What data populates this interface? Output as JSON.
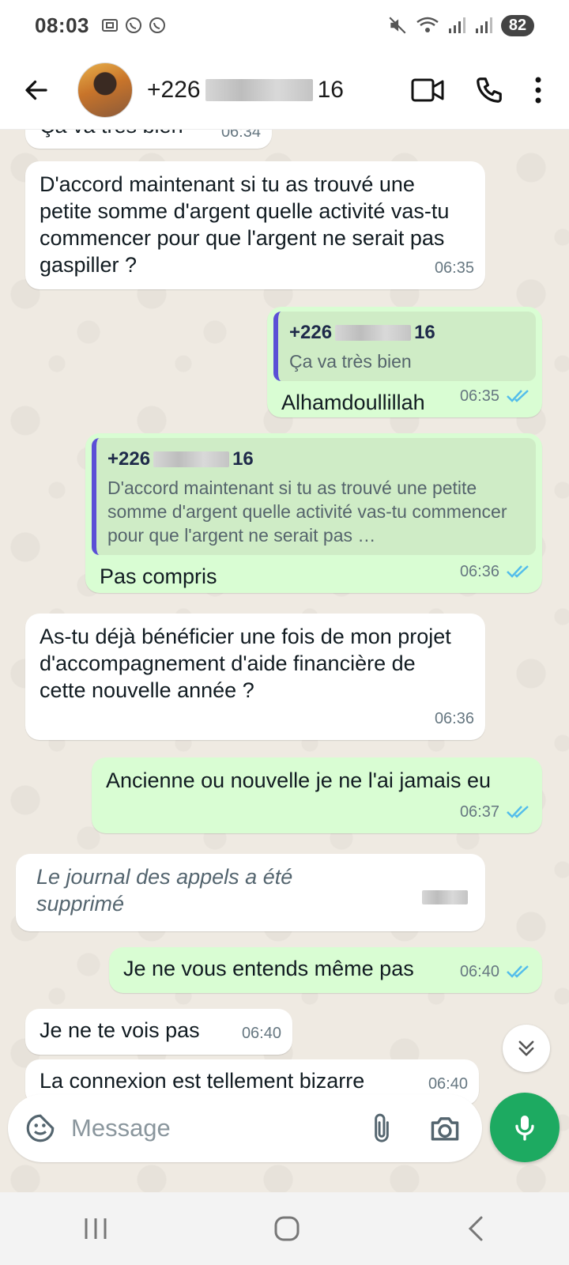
{
  "status_bar": {
    "time": "08:03",
    "battery": "82"
  },
  "header": {
    "contact_prefix": "+226",
    "contact_suffix": "16"
  },
  "messages": [
    {
      "id": "m0",
      "dir": "in",
      "text": "Ça va très bien",
      "time": "06:34"
    },
    {
      "id": "m1",
      "dir": "in",
      "text": "D'accord maintenant si tu as trouvé une petite somme d'argent quelle activité vas-tu commencer pour que l'argent ne serait pas gaspiller ?",
      "time": "06:35"
    },
    {
      "id": "m2",
      "dir": "out",
      "quote_name_prefix": "+226",
      "quote_name_suffix": "16",
      "quote_text": "Ça va très bien",
      "text": "Alhamdoullillah",
      "time": "06:35"
    },
    {
      "id": "m3",
      "dir": "out",
      "quote_name_prefix": "+226",
      "quote_name_suffix": "16",
      "quote_text": "D'accord maintenant si tu as trouvé une petite somme d'argent quelle activité vas-tu commencer pour que l'argent ne serait pas …",
      "text": "Pas compris",
      "time": "06:36"
    },
    {
      "id": "m4",
      "dir": "in",
      "text": "As-tu déjà bénéficier une fois de mon projet d'accompagnement d'aide financière de cette nouvelle année ?",
      "time": "06:36"
    },
    {
      "id": "m5",
      "dir": "out",
      "text": "Ancienne ou nouvelle je ne l'ai jamais eu",
      "time": "06:37"
    },
    {
      "id": "m6",
      "dir": "in",
      "text": "Le journal des appels a été supprimé",
      "time": ""
    },
    {
      "id": "m7",
      "dir": "out",
      "text": "Je ne vous entends même pas",
      "time": "06:40"
    },
    {
      "id": "m8",
      "dir": "in",
      "text": "Je ne te vois pas",
      "time": "06:40"
    },
    {
      "id": "m9",
      "dir": "in",
      "text": "La connexion est tellement bizarre",
      "time": "06:40"
    }
  ],
  "composer": {
    "placeholder": "Message"
  },
  "colors": {
    "chat_bg": "#efeae2",
    "outgoing_bubble": "#d9fdd3",
    "incoming_bubble": "#ffffff",
    "read_ticks": "#53bdeb",
    "mic_button": "#1daa61",
    "quote_bar": "#5b4fd6"
  },
  "icons": [
    "arrow-left-icon",
    "video-call-icon",
    "phone-icon",
    "more-vert-icon",
    "sticker-icon",
    "paperclip-icon",
    "camera-icon",
    "mic-icon",
    "double-chevron-down-icon",
    "double-check-icon"
  ]
}
